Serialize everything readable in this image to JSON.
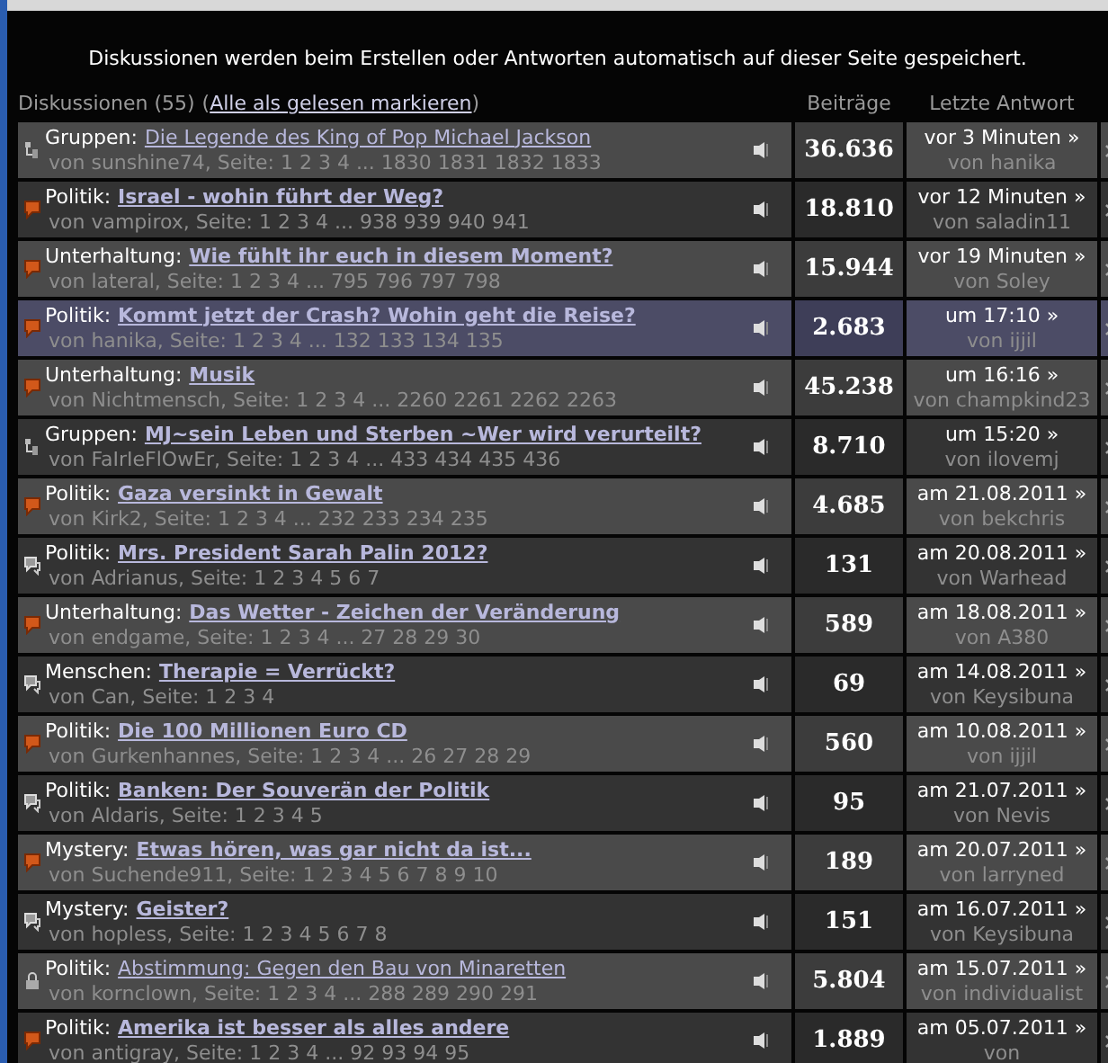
{
  "notice": "Diskussionen werden beim Erstellen oder Antworten automatisch auf dieser Seite gespeichert.",
  "header": {
    "count_label": "Diskussionen (55)",
    "open_paren": "(",
    "mark_all_link": "Alle als gelesen markieren",
    "close_paren": ")",
    "posts": "Beiträge",
    "last_reply": "Letzte Antwort"
  },
  "topics": [
    {
      "kind": "group",
      "category": "Gruppen:",
      "title": "Die Legende des King of Pop Michael Jackson",
      "unread": false,
      "selected": false,
      "meta": "von sunshine74, Seite: 1 2 3 4 ... 1830 1831 1832 1833",
      "posts": "36.636",
      "last_when": "vor 3 Minuten »",
      "last_by": "von hanika"
    },
    {
      "kind": "hot",
      "category": "Politik:",
      "title": "Israel - wohin führt der Weg?",
      "unread": true,
      "selected": false,
      "meta": "von vampirox, Seite: 1 2 3 4 ... 938 939 940 941",
      "posts": "18.810",
      "last_when": "vor 12 Minuten »",
      "last_by": "von saladin11"
    },
    {
      "kind": "hot",
      "category": "Unterhaltung:",
      "title": "Wie fühlt ihr euch in diesem Moment?",
      "unread": true,
      "selected": false,
      "meta": "von lateral, Seite: 1 2 3 4 ... 795 796 797 798",
      "posts": "15.944",
      "last_when": "vor 19 Minuten »",
      "last_by": "von Soley"
    },
    {
      "kind": "hot",
      "category": "Politik:",
      "title": "Kommt jetzt der Crash? Wohin geht die Reise?",
      "unread": true,
      "selected": true,
      "meta": "von hanika, Seite: 1 2 3 4 ... 132 133 134 135",
      "posts": "2.683",
      "last_when": "um 17:10 »",
      "last_by": "von ijjil"
    },
    {
      "kind": "hot",
      "category": "Unterhaltung:",
      "title": "Musik",
      "unread": true,
      "selected": false,
      "meta": "von Nichtmensch, Seite: 1 2 3 4 ... 2260 2261 2262 2263",
      "posts": "45.238",
      "last_when": "um 16:16 »",
      "last_by": "von champkind23"
    },
    {
      "kind": "group",
      "category": "Gruppen:",
      "title": "MJ~sein Leben und Sterben ~Wer wird verurteilt?",
      "unread": true,
      "selected": false,
      "meta": "von FaIrIeFlOwEr, Seite: 1 2 3 4 ... 433 434 435 436",
      "posts": "8.710",
      "last_when": "um 15:20 »",
      "last_by": "von ilovemj"
    },
    {
      "kind": "hot",
      "category": "Politik:",
      "title": "Gaza versinkt in Gewalt",
      "unread": true,
      "selected": false,
      "meta": "von Kirk2, Seite: 1 2 3 4 ... 232 233 234 235",
      "posts": "4.685",
      "last_when": "am 21.08.2011 »",
      "last_by": "von bekchris"
    },
    {
      "kind": "normal",
      "category": "Politik:",
      "title": "Mrs. President Sarah Palin 2012?",
      "unread": true,
      "selected": false,
      "meta": "von Adrianus, Seite: 1 2 3 4 5 6 7",
      "posts": "131",
      "last_when": "am 20.08.2011 »",
      "last_by": "von Warhead"
    },
    {
      "kind": "hot",
      "category": "Unterhaltung:",
      "title": "Das Wetter - Zeichen der Veränderung",
      "unread": true,
      "selected": false,
      "meta": "von endgame, Seite: 1 2 3 4 ... 27 28 29 30",
      "posts": "589",
      "last_when": "am 18.08.2011 »",
      "last_by": "von A380"
    },
    {
      "kind": "normal",
      "category": "Menschen:",
      "title": "Therapie = Verrückt?",
      "unread": true,
      "selected": false,
      "meta": "von Can, Seite: 1 2 3 4",
      "posts": "69",
      "last_when": "am 14.08.2011 »",
      "last_by": "von Keysibuna"
    },
    {
      "kind": "hot",
      "category": "Politik:",
      "title": "Die 100 Millionen Euro CD",
      "unread": true,
      "selected": false,
      "meta": "von Gurkenhannes, Seite: 1 2 3 4 ... 26 27 28 29",
      "posts": "560",
      "last_when": "am 10.08.2011 »",
      "last_by": "von ijjil"
    },
    {
      "kind": "normal",
      "category": "Politik:",
      "title": "Banken: Der Souverän der Politik",
      "unread": true,
      "selected": false,
      "meta": "von Aldaris, Seite: 1 2 3 4 5",
      "posts": "95",
      "last_when": "am 21.07.2011 »",
      "last_by": "von Nevis"
    },
    {
      "kind": "hot",
      "category": "Mystery:",
      "title": "Etwas hören, was gar nicht da ist...",
      "unread": true,
      "selected": false,
      "meta": "von Suchende911, Seite: 1 2 3 4 5 6 7 8 9 10",
      "posts": "189",
      "last_when": "am 20.07.2011 »",
      "last_by": "von larryned"
    },
    {
      "kind": "normal",
      "category": "Mystery:",
      "title": "Geister?",
      "unread": true,
      "selected": false,
      "meta": "von hopless, Seite: 1 2 3 4 5 6 7 8",
      "posts": "151",
      "last_when": "am 16.07.2011 »",
      "last_by": "von Keysibuna"
    },
    {
      "kind": "locked",
      "category": "Politik:",
      "title": "Abstimmung: Gegen den Bau von Minaretten",
      "unread": false,
      "selected": false,
      "meta": "von kornclown, Seite: 1 2 3 4 ... 288 289 290 291",
      "posts": "5.804",
      "last_when": "am 15.07.2011 »",
      "last_by": "von individualist"
    },
    {
      "kind": "hot",
      "category": "Politik:",
      "title": "Amerika ist besser als alles andere",
      "unread": true,
      "selected": false,
      "meta": "von antigray, Seite: 1 2 3 4 ... 92 93 94 95",
      "posts": "1.889",
      "last_when": "am 05.07.2011 »",
      "last_by": "von"
    }
  ]
}
